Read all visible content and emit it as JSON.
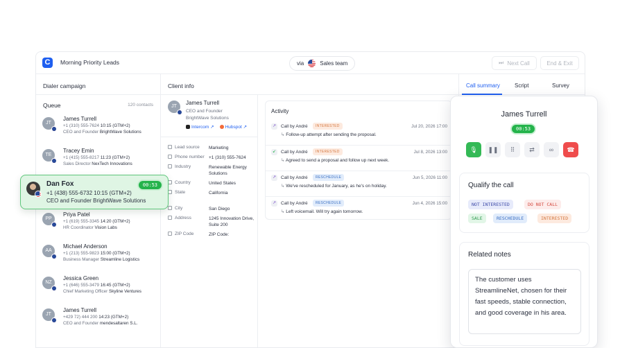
{
  "header": {
    "app_title": "Morning Priority Leads",
    "via_label": "via",
    "team": "Sales team",
    "next_call": "Next Call",
    "end_exit": "End & Exit"
  },
  "dialer": {
    "section_title": "Dialer campaign",
    "queue_title": "Queue",
    "queue_count": "120 contacts",
    "contacts": [
      {
        "initials": "JT",
        "name": "James Turrell",
        "phone": "+1 (310) 555-7624",
        "time": "10:15 (GTM+2)",
        "title": "CEO and Founder",
        "company": "BrightWave Solutions"
      },
      {
        "initials": "TE",
        "name": "Tracey Emin",
        "phone": "+1 (415) 555-8217",
        "time": "11:23 (GTM+2)",
        "title": "Sales Director",
        "company": "NexTech Innovations"
      },
      {
        "initials": "PP",
        "name": "Priya Patel",
        "phone": "+1 (619) 555-3345",
        "time": "14:20 (GTM+2)",
        "title": "HR Coordinator",
        "company": "Vision Labs"
      },
      {
        "initials": "AA",
        "name": "Michael Anderson",
        "phone": "+1 (213) 555-9823",
        "time": "15:00 (GTM+2)",
        "title": "Business Manager",
        "company": "Streamline Logistics"
      },
      {
        "initials": "NZ",
        "name": "Jessica Green",
        "phone": "+1 (646) 555-3479",
        "time": "16:45 (GTM+2)",
        "title": "Chief Marketing Officer",
        "company": "Skyline Ventures"
      },
      {
        "initials": "JT",
        "name": "James Turrell",
        "phone": "+429 72) 444 200",
        "time": "14:23 (GTM+2)",
        "title": "CEO and Founder",
        "company": "mendesaltaren S.L."
      }
    ],
    "active": {
      "name": "Dan Fox",
      "phone": "+1 (438) 555-6732",
      "time": "10:15 (GTM+2)",
      "title": "CEO and Founder",
      "company": "BrightWave Solutions",
      "timer": "00:53"
    }
  },
  "client": {
    "section_title": "Client info",
    "initials": "JT",
    "name": "James Turrell",
    "role": "CEO and Founder",
    "company": "BrightWave Solutions",
    "links": [
      "Intercom",
      "Hubspot"
    ],
    "fields": [
      {
        "label": "Lead source",
        "value": "Marketing"
      },
      {
        "label": "Phone number",
        "value": "+1 (310) 555-7624"
      },
      {
        "label": "Industry",
        "value": "Renewable Energy Solutions"
      },
      {
        "label": "Country",
        "value": "United States"
      },
      {
        "label": "State",
        "value": "California"
      },
      {
        "label": "City",
        "value": "San Diego"
      },
      {
        "label": "Address",
        "value": "1245 Innovation Drive, Suite 200"
      },
      {
        "label": "ZIP Code",
        "value": "ZIP Code:"
      }
    ]
  },
  "activity": {
    "title": "Activity",
    "items": [
      {
        "label": "Call by André",
        "tag": "INTERESTED",
        "date": "Jul 20, 2026 17:00",
        "note": "Follow-up attempt after sending the proposal."
      },
      {
        "label": "Call by André",
        "tag": "INTERESTED",
        "date": "Jul 8, 2026 13:00",
        "note": "Agreed to send a proposal and follow up next week."
      },
      {
        "label": "Call by André",
        "tag": "RESCHEDULE",
        "date": "Jun 5, 2026 11:00",
        "note": "We've rescheduled for January, as he's on holiday."
      },
      {
        "label": "Call by André",
        "tag": "RESCHEDULE",
        "date": "Jun 4, 2026 15:00",
        "note": "Left voicemail. Will try again tomorrow."
      }
    ]
  },
  "tabs": [
    "Call summary",
    "Script",
    "Survey"
  ],
  "summary": {
    "name": "James Turrell",
    "timer": "00:53",
    "qualify_title": "Qualify the call",
    "chips": [
      "NOT INTERESTED",
      "DO NOT CALL",
      "SALE",
      "RESCHEDULE",
      "INTERESTED"
    ],
    "notes_title": "Related notes",
    "notes_text": "The customer uses StreamlineNet, chosen for their fast speeds, stable connection, and good coverage in his area."
  },
  "colors": {
    "accent": "#1f5ff0",
    "success": "#24b34b",
    "danger": "#ef4c4c"
  }
}
